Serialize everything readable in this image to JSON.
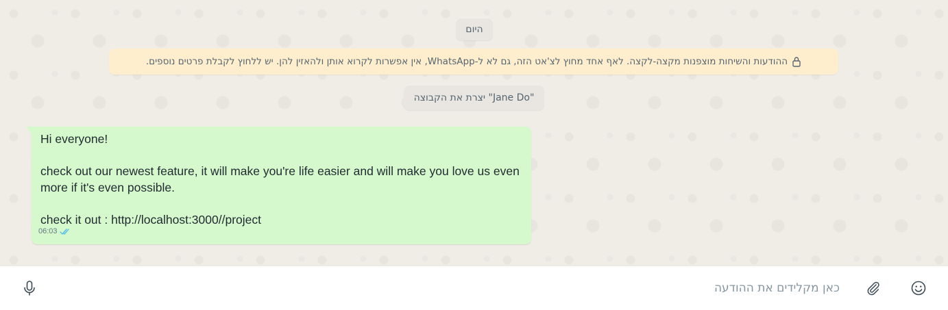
{
  "chat": {
    "date_label": "היום",
    "encryption_notice": "ההודעות והשיחות מוצפנות מקצה-לקצה. לאף אחד מחוץ לצ'אט הזה, גם לא ל-WhatsApp, אין אפשרות לקרוא אותן ולהאזין להן. יש ללחוץ לקבלת פרטים נוספים.",
    "system_message": "יצרת את הקבוצה \"Jane Do\"",
    "messages": [
      {
        "line1": "Hi everyone!",
        "line2": "check out our newest feature, it will make you're life easier and will make you love us even",
        "line3": "more if it's even possible.",
        "line4": "check it out : http://localhost:3000//project",
        "time": "06:03",
        "status": "read"
      }
    ]
  },
  "composer": {
    "placeholder": "כאן מקלידים את ההודעה",
    "value": ""
  },
  "icons": {
    "lock": "lock-icon",
    "read_receipt": "double-check-icon",
    "mic": "microphone-icon",
    "attach": "paperclip-icon",
    "emoji": "smiley-icon"
  },
  "colors": {
    "chat_background": "#f0ece6",
    "outgoing_bubble": "#d5f9cc",
    "notice_background": "#ffeecd",
    "read_tick": "#53bdeb"
  }
}
